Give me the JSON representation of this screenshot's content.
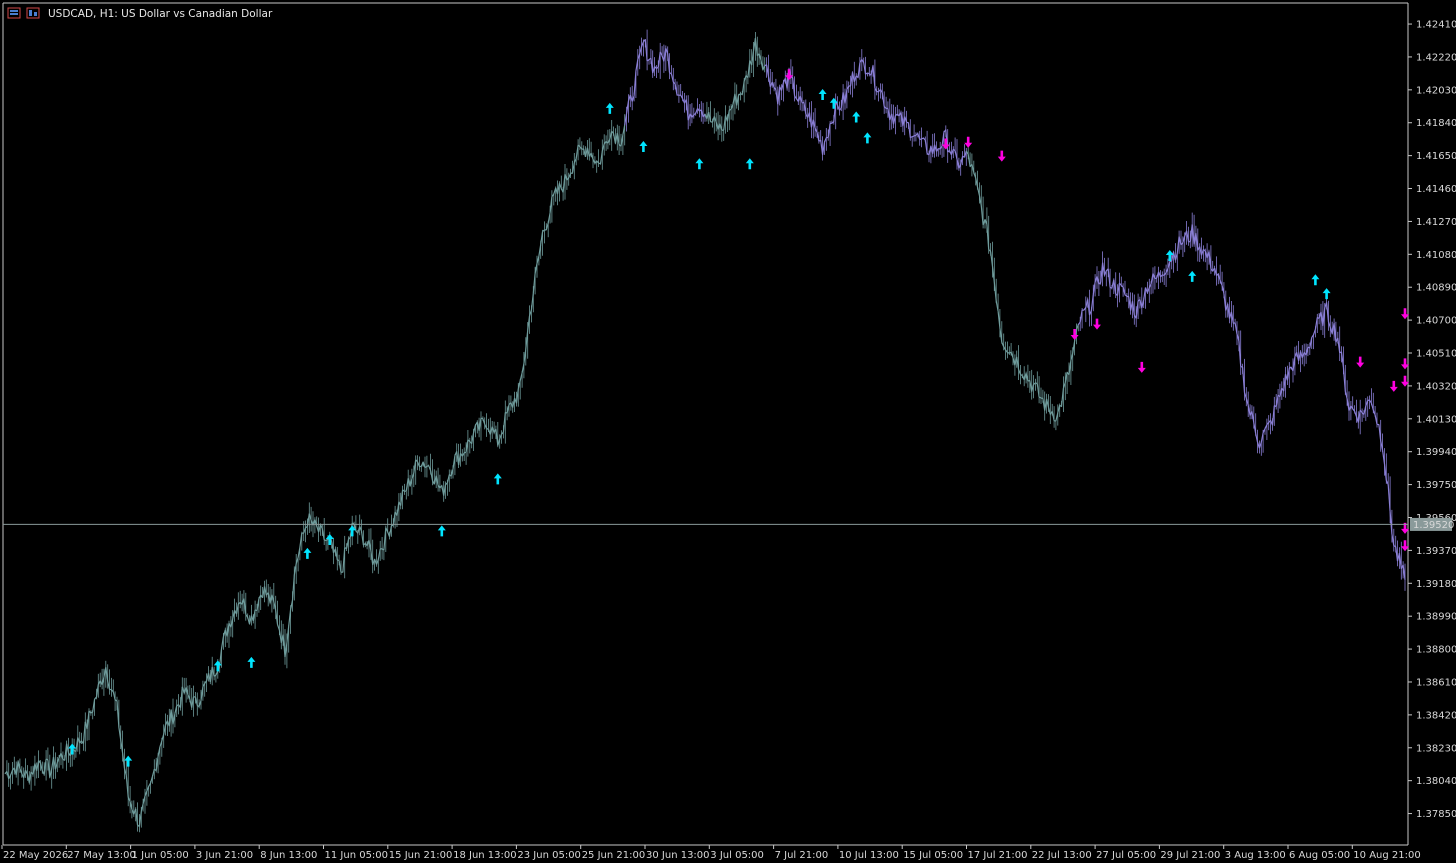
{
  "window": {
    "title": "USDCAD, H1:  US Dollar vs Canadian Dollar",
    "icons": [
      "chart-window-icon",
      "symbol-properties-icon"
    ]
  },
  "colors": {
    "background": "#000000",
    "frame": "#c8c8c8",
    "axis_text": "#d8d8d8",
    "bull_line": "#6f9c9c",
    "bear_line": "#8a7fd6",
    "buy_arrow": "#00e5ff",
    "sell_arrow": "#ff00e0",
    "bid_line": "#8a9a9a",
    "bid_label_bg": "#8a9a9a"
  },
  "chart_data": {
    "type": "line",
    "symbol": "USDCAD",
    "timeframe": "H1",
    "title": "USDCAD, H1:  US Dollar vs Canadian Dollar",
    "ylim": [
      1.3768,
      1.4252
    ],
    "y_ticks": [
      "1.42410",
      "1.42220",
      "1.42030",
      "1.41840",
      "1.41650",
      "1.41460",
      "1.41270",
      "1.41080",
      "1.40890",
      "1.40700",
      "1.40510",
      "1.40320",
      "1.40130",
      "1.39940",
      "1.39750",
      "1.39560",
      "1.39370",
      "1.39180",
      "1.38990",
      "1.38800",
      "1.38610",
      "1.38420",
      "1.38230",
      "1.38040",
      "1.37850"
    ],
    "x_ticks": [
      "22 May 2026",
      "27 May 13:00",
      "1 Jun 05:00",
      "3 Jun 21:00",
      "8 Jun 13:00",
      "11 Jun 05:00",
      "15 Jun 21:00",
      "18 Jun 13:00",
      "23 Jun 05:00",
      "25 Jun 21:00",
      "30 Jun 13:00",
      "3 Jul 05:00",
      "7 Jul 21:00",
      "10 Jul 13:00",
      "15 Jul 05:00",
      "17 Jul 21:00",
      "22 Jul 13:00",
      "27 Jul 05:00",
      "29 Jul 21:00",
      "3 Aug 13:00",
      "6 Aug 05:00",
      "10 Aug 21:00"
    ],
    "current_price": "1.39520",
    "current_value": 1.3952,
    "series": [
      {
        "x": [
          0,
          2,
          4,
          6,
          8,
          10,
          12,
          14,
          16,
          18,
          20,
          22,
          24,
          26,
          28,
          30,
          32,
          34,
          36,
          38,
          40,
          42,
          44,
          46,
          48,
          50,
          52,
          54,
          56,
          58,
          60,
          62,
          64,
          66,
          68,
          70,
          72,
          74,
          76,
          78,
          80,
          82,
          84,
          86,
          88,
          90,
          92,
          94,
          96,
          98,
          100,
          102,
          104,
          106,
          108,
          110,
          112,
          114,
          116,
          118,
          120,
          122,
          124,
          126,
          128,
          130,
          132,
          134,
          136,
          138,
          140,
          142,
          144,
          146,
          148,
          150,
          152,
          154,
          156,
          158,
          160,
          162,
          164,
          166,
          168,
          170,
          172,
          174,
          176,
          178,
          180,
          182,
          184,
          186,
          188,
          190,
          192,
          194,
          196,
          198,
          200,
          202,
          204,
          206,
          208,
          210,
          212,
          214,
          216,
          218,
          220,
          222,
          224,
          226,
          228,
          230,
          232,
          234,
          236,
          238,
          240,
          242,
          244,
          246,
          248,
          250
        ],
        "values": [
          1.3808,
          1.3812,
          1.3806,
          1.3815,
          1.381,
          1.3818,
          1.3822,
          1.383,
          1.385,
          1.387,
          1.3845,
          1.3795,
          1.378,
          1.38,
          1.383,
          1.3842,
          1.3855,
          1.3848,
          1.386,
          1.3872,
          1.3895,
          1.391,
          1.3898,
          1.3915,
          1.3905,
          1.388,
          1.393,
          1.3955,
          1.3948,
          1.394,
          1.3925,
          1.395,
          1.3945,
          1.393,
          1.3945,
          1.396,
          1.3975,
          1.399,
          1.3985,
          1.397,
          1.3988,
          1.3995,
          1.4005,
          1.4012,
          1.4,
          1.4018,
          1.403,
          1.408,
          1.412,
          1.414,
          1.415,
          1.4165,
          1.417,
          1.416,
          1.418,
          1.4175,
          1.42,
          1.423,
          1.4215,
          1.4225,
          1.4205,
          1.419,
          1.4195,
          1.4185,
          1.418,
          1.4195,
          1.4205,
          1.423,
          1.4215,
          1.42,
          1.421,
          1.4195,
          1.4185,
          1.417,
          1.419,
          1.4198,
          1.4215,
          1.4218,
          1.4205,
          1.419,
          1.4185,
          1.418,
          1.417,
          1.4168,
          1.4175,
          1.416,
          1.4165,
          1.414,
          1.411,
          1.406,
          1.405,
          1.404,
          1.403,
          1.402,
          1.4015,
          1.404,
          1.407,
          1.408,
          1.41,
          1.409,
          1.4085,
          1.4075,
          1.409,
          1.4095,
          1.4105,
          1.4115,
          1.412,
          1.411,
          1.41,
          1.408,
          1.406,
          1.402,
          1.4,
          1.401,
          1.403,
          1.4045,
          1.405,
          1.4065,
          1.4075,
          1.406,
          1.402,
          1.4015,
          1.4025,
          1.4,
          1.394,
          1.392
        ]
      }
    ],
    "grid": false,
    "buy_signals_at": [
      [
        12,
        1.3822
      ],
      [
        22,
        1.3815
      ],
      [
        38,
        1.387
      ],
      [
        44,
        1.3872
      ],
      [
        54,
        1.3935
      ],
      [
        58,
        1.3943
      ],
      [
        62,
        1.3948
      ],
      [
        78,
        1.3948
      ],
      [
        88,
        1.3978
      ],
      [
        108,
        1.4192
      ],
      [
        114,
        1.417
      ],
      [
        124,
        1.416
      ],
      [
        133,
        1.416
      ],
      [
        146,
        1.42
      ],
      [
        148,
        1.4195
      ],
      [
        152,
        1.4187
      ],
      [
        154,
        1.4175
      ],
      [
        208,
        1.4107
      ],
      [
        212,
        1.4095
      ],
      [
        234,
        1.4093
      ],
      [
        236,
        1.4085
      ]
    ],
    "sell_signals_at": [
      [
        140,
        1.4212
      ],
      [
        168,
        1.4172
      ],
      [
        172,
        1.4173
      ],
      [
        178,
        1.4165
      ],
      [
        191,
        1.4062
      ],
      [
        195,
        1.4068
      ],
      [
        203,
        1.4043
      ],
      [
        242,
        1.4046
      ],
      [
        248,
        1.4032
      ],
      [
        254,
        1.4045
      ],
      [
        260,
        1.4074
      ],
      [
        272,
        1.4035
      ],
      [
        284,
        1.394
      ],
      [
        290,
        1.395
      ]
    ]
  }
}
